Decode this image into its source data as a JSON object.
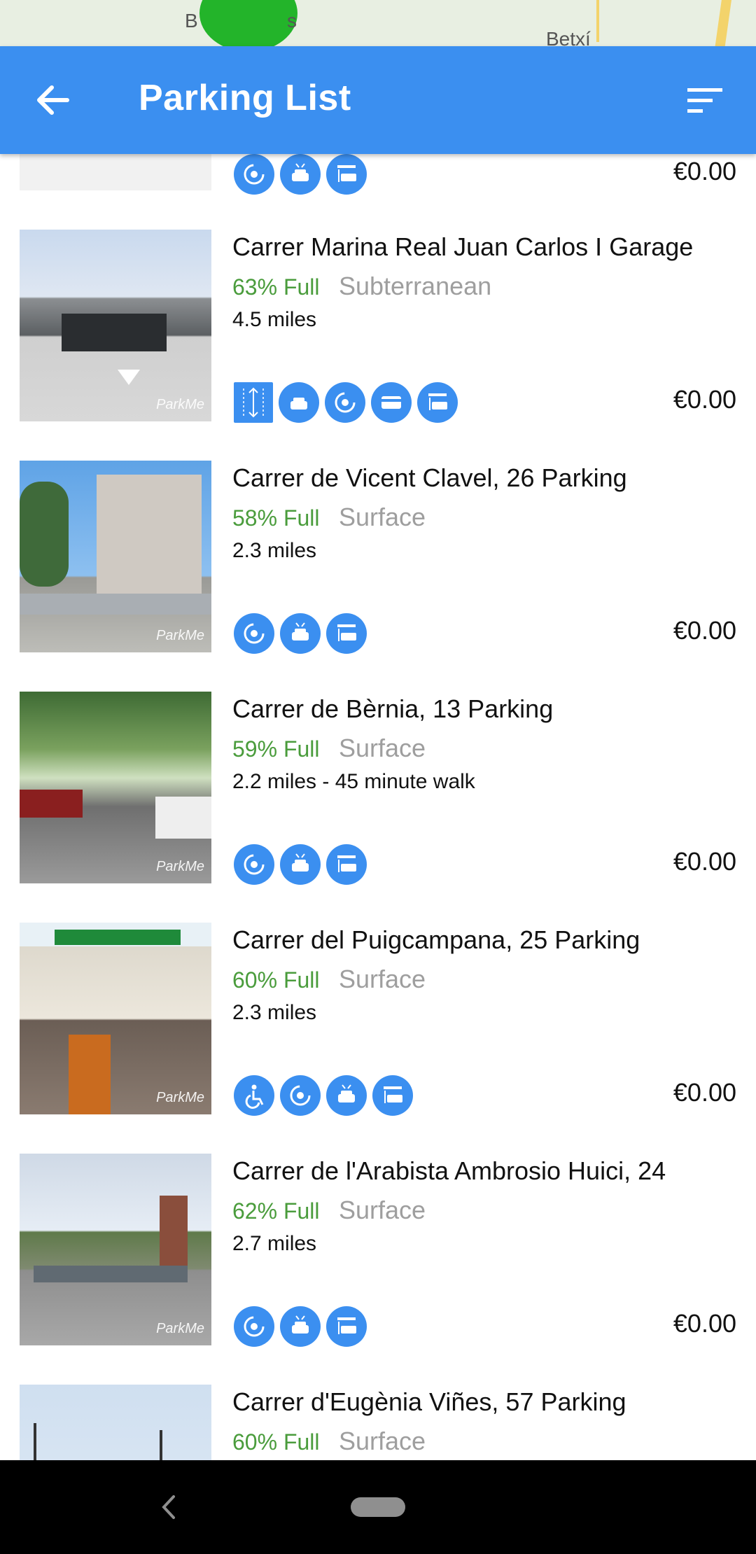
{
  "map": {
    "label_left": "B",
    "label_left2": "s",
    "label_right": "Betxí"
  },
  "app_bar": {
    "title": "Parking List",
    "back_icon": "arrow-left-icon",
    "sort_icon": "sort-icon"
  },
  "partial_item": {
    "price": "€0.00"
  },
  "items": [
    {
      "title": "Carrer Marina Real Juan Carlos I Garage",
      "occupancy": "63% Full",
      "type": "Subterranean",
      "distance": "4.5 miles",
      "price": "€0.00",
      "amenities": [
        "height-limit-icon",
        "car-wash-icon",
        "open-24h-icon",
        "credit-card-icon",
        "car-entrance-icon"
      ]
    },
    {
      "title": "Carrer de Vicent Clavel, 26 Parking",
      "occupancy": "58% Full",
      "type": "Surface",
      "distance": "2.3 miles",
      "price": "€0.00",
      "amenities": [
        "open-24h-icon",
        "car-wash-icon",
        "car-entrance-icon"
      ]
    },
    {
      "title": "Carrer de Bèrnia, 13 Parking",
      "occupancy": "59% Full",
      "type": "Surface",
      "distance": "2.2 miles - 45 minute walk",
      "price": "€0.00",
      "amenities": [
        "open-24h-icon",
        "car-wash-icon",
        "car-entrance-icon"
      ]
    },
    {
      "title": "Carrer del Puigcampana, 25 Parking",
      "occupancy": "60% Full",
      "type": "Surface",
      "distance": "2.3 miles",
      "price": "€0.00",
      "amenities": [
        "wheelchair-icon",
        "open-24h-icon",
        "car-wash-icon",
        "car-entrance-icon"
      ]
    },
    {
      "title": "Carrer de l'Arabista Ambrosio Huici, 24",
      "occupancy": "62% Full",
      "type": "Surface",
      "distance": "2.7 miles",
      "price": "€0.00",
      "amenities": [
        "open-24h-icon",
        "car-wash-icon",
        "car-entrance-icon"
      ]
    },
    {
      "title": "Carrer d'Eugènia Viñes, 57 Parking",
      "occupancy": "60% Full",
      "type": "Surface",
      "distance": "",
      "price": "",
      "amenities": []
    }
  ],
  "colors": {
    "accent": "#3b8ff0",
    "occupancy_green": "#4a9c3c",
    "type_gray": "#9e9e9e"
  }
}
